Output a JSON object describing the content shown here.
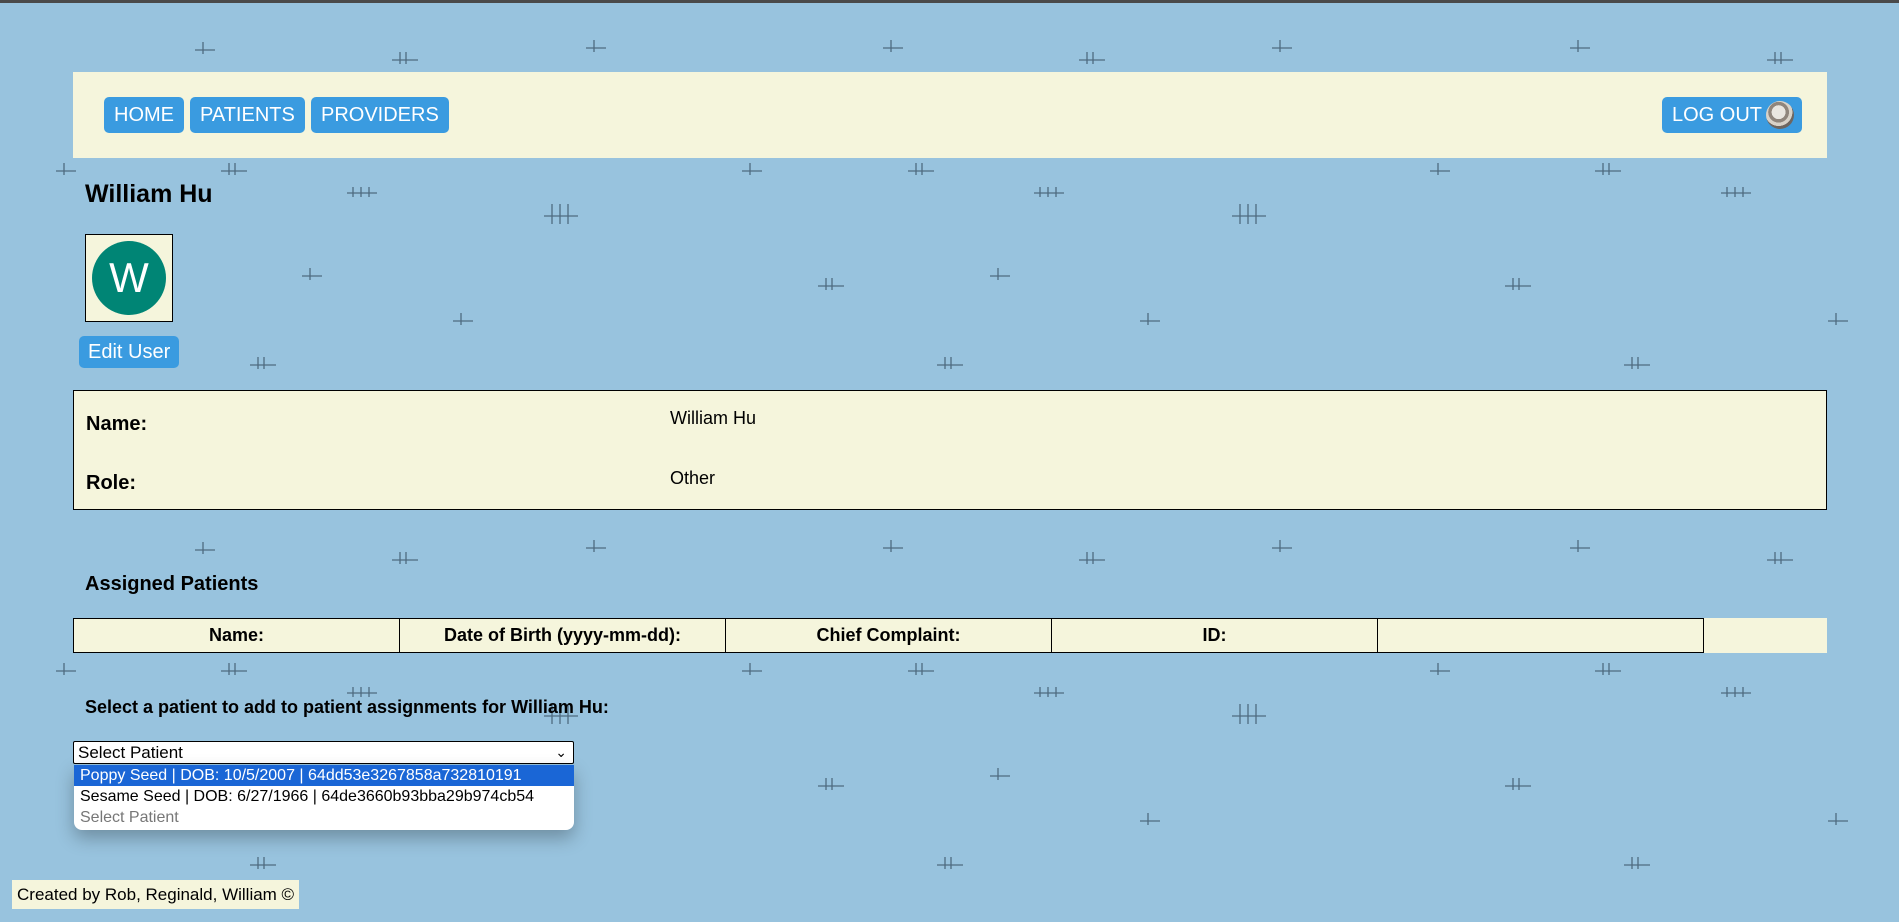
{
  "nav": {
    "home": "HOME",
    "patients": "PATIENTS",
    "providers": "PROVIDERS",
    "logout": "LOG OUT"
  },
  "user": {
    "title": "William Hu",
    "avatar_initial": "W",
    "avatar_color": "#008575",
    "edit_button": "Edit User"
  },
  "details": {
    "name_label": "Name:",
    "name_value": "William Hu",
    "role_label": "Role:",
    "role_value": "Other"
  },
  "assigned": {
    "title": "Assigned Patients",
    "columns": [
      "Name:",
      "Date of Birth (yyyy-mm-dd):",
      "Chief Complaint:",
      "ID:",
      ""
    ]
  },
  "assign": {
    "label": "Select a patient to add to patient assignments for William Hu:",
    "selected": "Select Patient",
    "options": [
      "Poppy Seed | DOB: 10/5/2007 | 64dd53e3267858a732810191",
      "Sesame Seed | DOB: 6/27/1966 | 64de3660b93bba29b974cb54",
      "Select Patient"
    ]
  },
  "footer": "Created by Rob, Reginald, William ©",
  "colors": {
    "background": "#98c3de",
    "panel": "#f5f5dc",
    "button": "#3a9be0",
    "highlight": "#1a66d6"
  }
}
